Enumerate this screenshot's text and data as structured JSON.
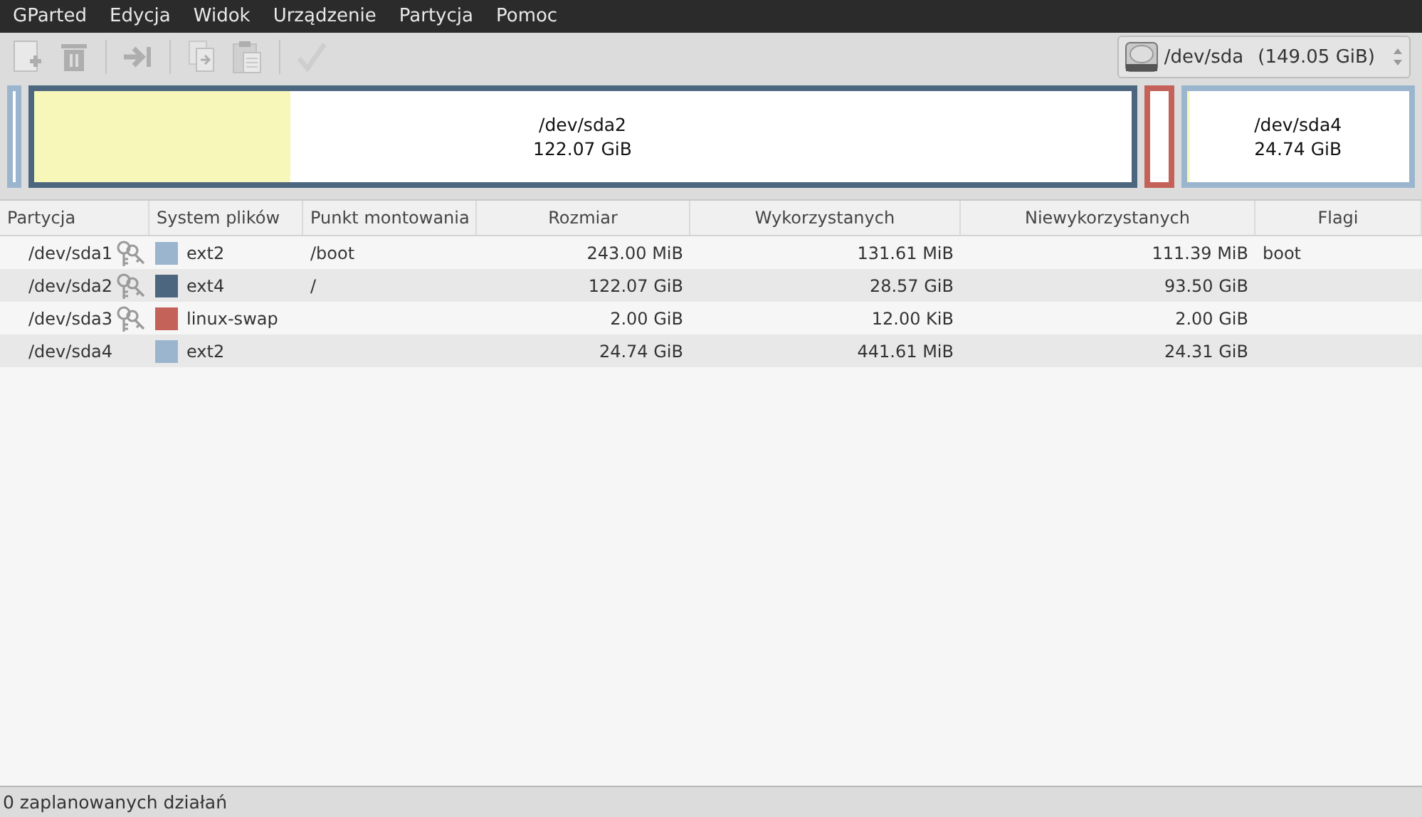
{
  "menu": [
    {
      "label": "GParted"
    },
    {
      "label": "Edycja"
    },
    {
      "label": "Widok"
    },
    {
      "label": "Urządzenie"
    },
    {
      "label": "Partycja"
    },
    {
      "label": "Pomoc"
    }
  ],
  "toolbar": [
    {
      "kind": "new",
      "disabled": true
    },
    {
      "kind": "delete",
      "disabled": true
    },
    {
      "kind": "separator"
    },
    {
      "kind": "resize",
      "disabled": true
    },
    {
      "kind": "separator"
    },
    {
      "kind": "copy",
      "disabled": true
    },
    {
      "kind": "paste",
      "disabled": true
    },
    {
      "kind": "separator"
    },
    {
      "kind": "apply",
      "disabled": true
    }
  ],
  "device": {
    "name": "/dev/sda",
    "size": "(149.05 GiB)"
  },
  "disk_map": [
    {
      "color": "#9bb5cf"
    },
    {
      "name": "/dev/sda2",
      "size": "122.07 GiB",
      "color": "#4d6680",
      "level": 0.234
    },
    {
      "color": "#c4625a"
    },
    {
      "name": "/dev/sda4",
      "size": "24.74 GiB",
      "color": "#9bb5cf",
      "level": 0.017
    }
  ],
  "table": {
    "columns": [
      "Partycja",
      "System plików",
      "Punkt montowania",
      "Rozmiar",
      "Wykorzystanych",
      "Niewykorzystanych",
      "Flagi"
    ],
    "rows": [
      {
        "partition": "/dev/sda1",
        "locked": true,
        "color": "#9bb5cf",
        "filesystem": "ext2",
        "mount": "/boot",
        "size": "243.00 MiB",
        "used": "131.61 MiB",
        "unused": "111.39 MiB",
        "flags": "boot"
      },
      {
        "partition": "/dev/sda2",
        "locked": true,
        "color": "#4d6680",
        "filesystem": "ext4",
        "mount": "/",
        "size": "122.07 GiB",
        "used": "28.57 GiB",
        "unused": "93.50 GiB"
      },
      {
        "partition": "/dev/sda3",
        "locked": true,
        "color": "#c4625a",
        "filesystem": "linux-swap",
        "size": "2.00 GiB",
        "used": "12.00 KiB",
        "unused": "2.00 GiB"
      },
      {
        "partition": "/dev/sda4",
        "locked": false,
        "color": "#9bb5cf",
        "filesystem": "ext2",
        "size": "24.74 GiB",
        "used": "441.61 MiB",
        "unused": "24.31 GiB"
      }
    ]
  },
  "status_bar": "0 zaplanowanych działań"
}
